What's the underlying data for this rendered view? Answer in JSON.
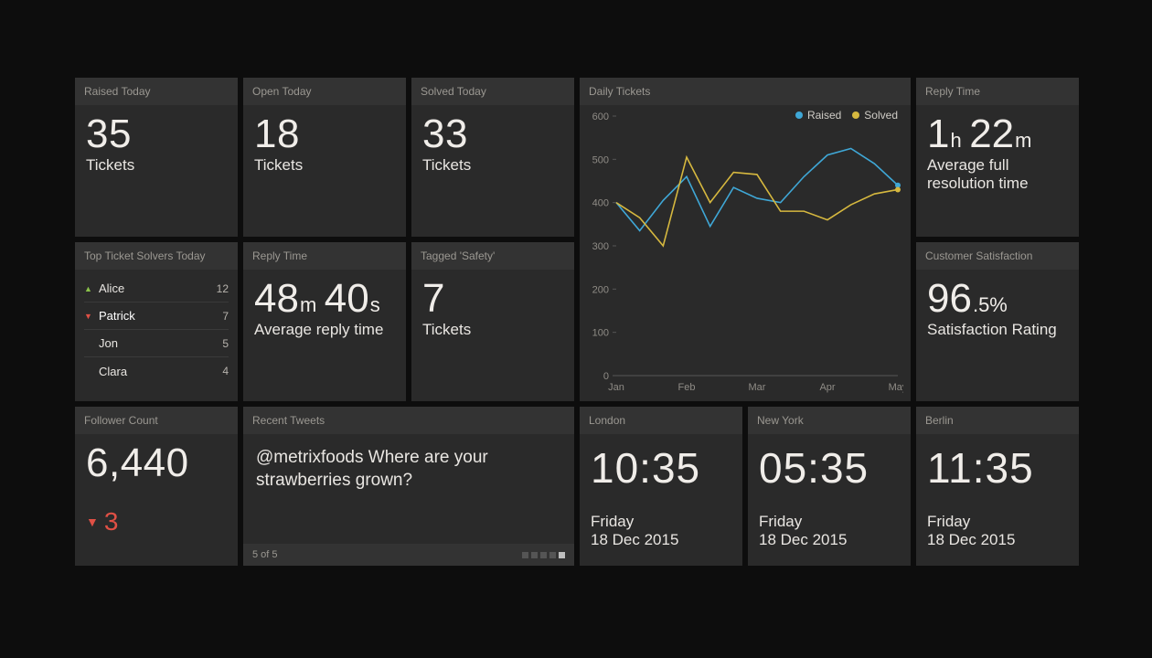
{
  "tiles": {
    "raised": {
      "title": "Raised Today",
      "value": "35",
      "unit": "Tickets"
    },
    "open": {
      "title": "Open Today",
      "value": "18",
      "unit": "Tickets"
    },
    "solved": {
      "title": "Solved Today",
      "value": "33",
      "unit": "Tickets"
    },
    "solvers": {
      "title": "Top Ticket Solvers Today",
      "rows": [
        {
          "name": "Alice",
          "value": "12",
          "trend": "up",
          "strong": false
        },
        {
          "name": "Patrick",
          "value": "7",
          "trend": "down",
          "strong": true
        },
        {
          "name": "Jon",
          "value": "5",
          "trend": "",
          "strong": false
        },
        {
          "name": "Clara",
          "value": "4",
          "trend": "",
          "strong": false
        }
      ]
    },
    "reply": {
      "title": "Reply Time",
      "v1": "48",
      "u1": "m",
      "v2": "40",
      "u2": "s",
      "caption": "Average reply time"
    },
    "tagged": {
      "title": "Tagged 'Safety'",
      "value": "7",
      "unit": "Tickets"
    },
    "daily": {
      "title": "Daily Tickets",
      "legend": {
        "a": "Raised",
        "b": "Solved",
        "colorA": "#3fa7d6",
        "colorB": "#d6b83f"
      }
    },
    "fullres": {
      "title": "Reply Time",
      "v1": "1",
      "u1": "h",
      "v2": "22",
      "u2": "m",
      "caption": "Average full resolution time"
    },
    "csat": {
      "title": "Customer Satisfaction",
      "main": "96",
      "frac": ".5%",
      "caption": "Satisfaction Rating"
    },
    "follow": {
      "title": "Follower Count",
      "value": "6,440",
      "delta": "3"
    },
    "tweets": {
      "title": "Recent Tweets",
      "text": "@metrixfoods Where are your strawberries grown?",
      "page": "5 of 5"
    },
    "london": {
      "title": "London",
      "time": "10:35",
      "day": "Friday",
      "date": "18 Dec 2015"
    },
    "ny": {
      "title": "New York",
      "time": "05:35",
      "day": "Friday",
      "date": "18 Dec 2015"
    },
    "berlin": {
      "title": "Berlin",
      "time": "11:35",
      "day": "Friday",
      "date": "18 Dec 2015"
    }
  },
  "chart_data": {
    "type": "line",
    "title": "Daily Tickets",
    "xlabel": "",
    "ylabel": "",
    "ylim": [
      0,
      600
    ],
    "yticks": [
      0,
      100,
      200,
      300,
      400,
      500,
      600
    ],
    "categories": [
      "Jan",
      "Feb",
      "Mar",
      "Apr",
      "May"
    ],
    "x": [
      0,
      1,
      2,
      3,
      4,
      5,
      6,
      7,
      8,
      9,
      10,
      11,
      12
    ],
    "series": [
      {
        "name": "Raised",
        "color": "#3fa7d6",
        "values": [
          400,
          335,
          405,
          460,
          345,
          435,
          410,
          400,
          460,
          510,
          525,
          490,
          440
        ]
      },
      {
        "name": "Solved",
        "color": "#d6b83f",
        "values": [
          400,
          365,
          300,
          505,
          400,
          470,
          465,
          380,
          380,
          360,
          395,
          420,
          430
        ]
      }
    ]
  }
}
